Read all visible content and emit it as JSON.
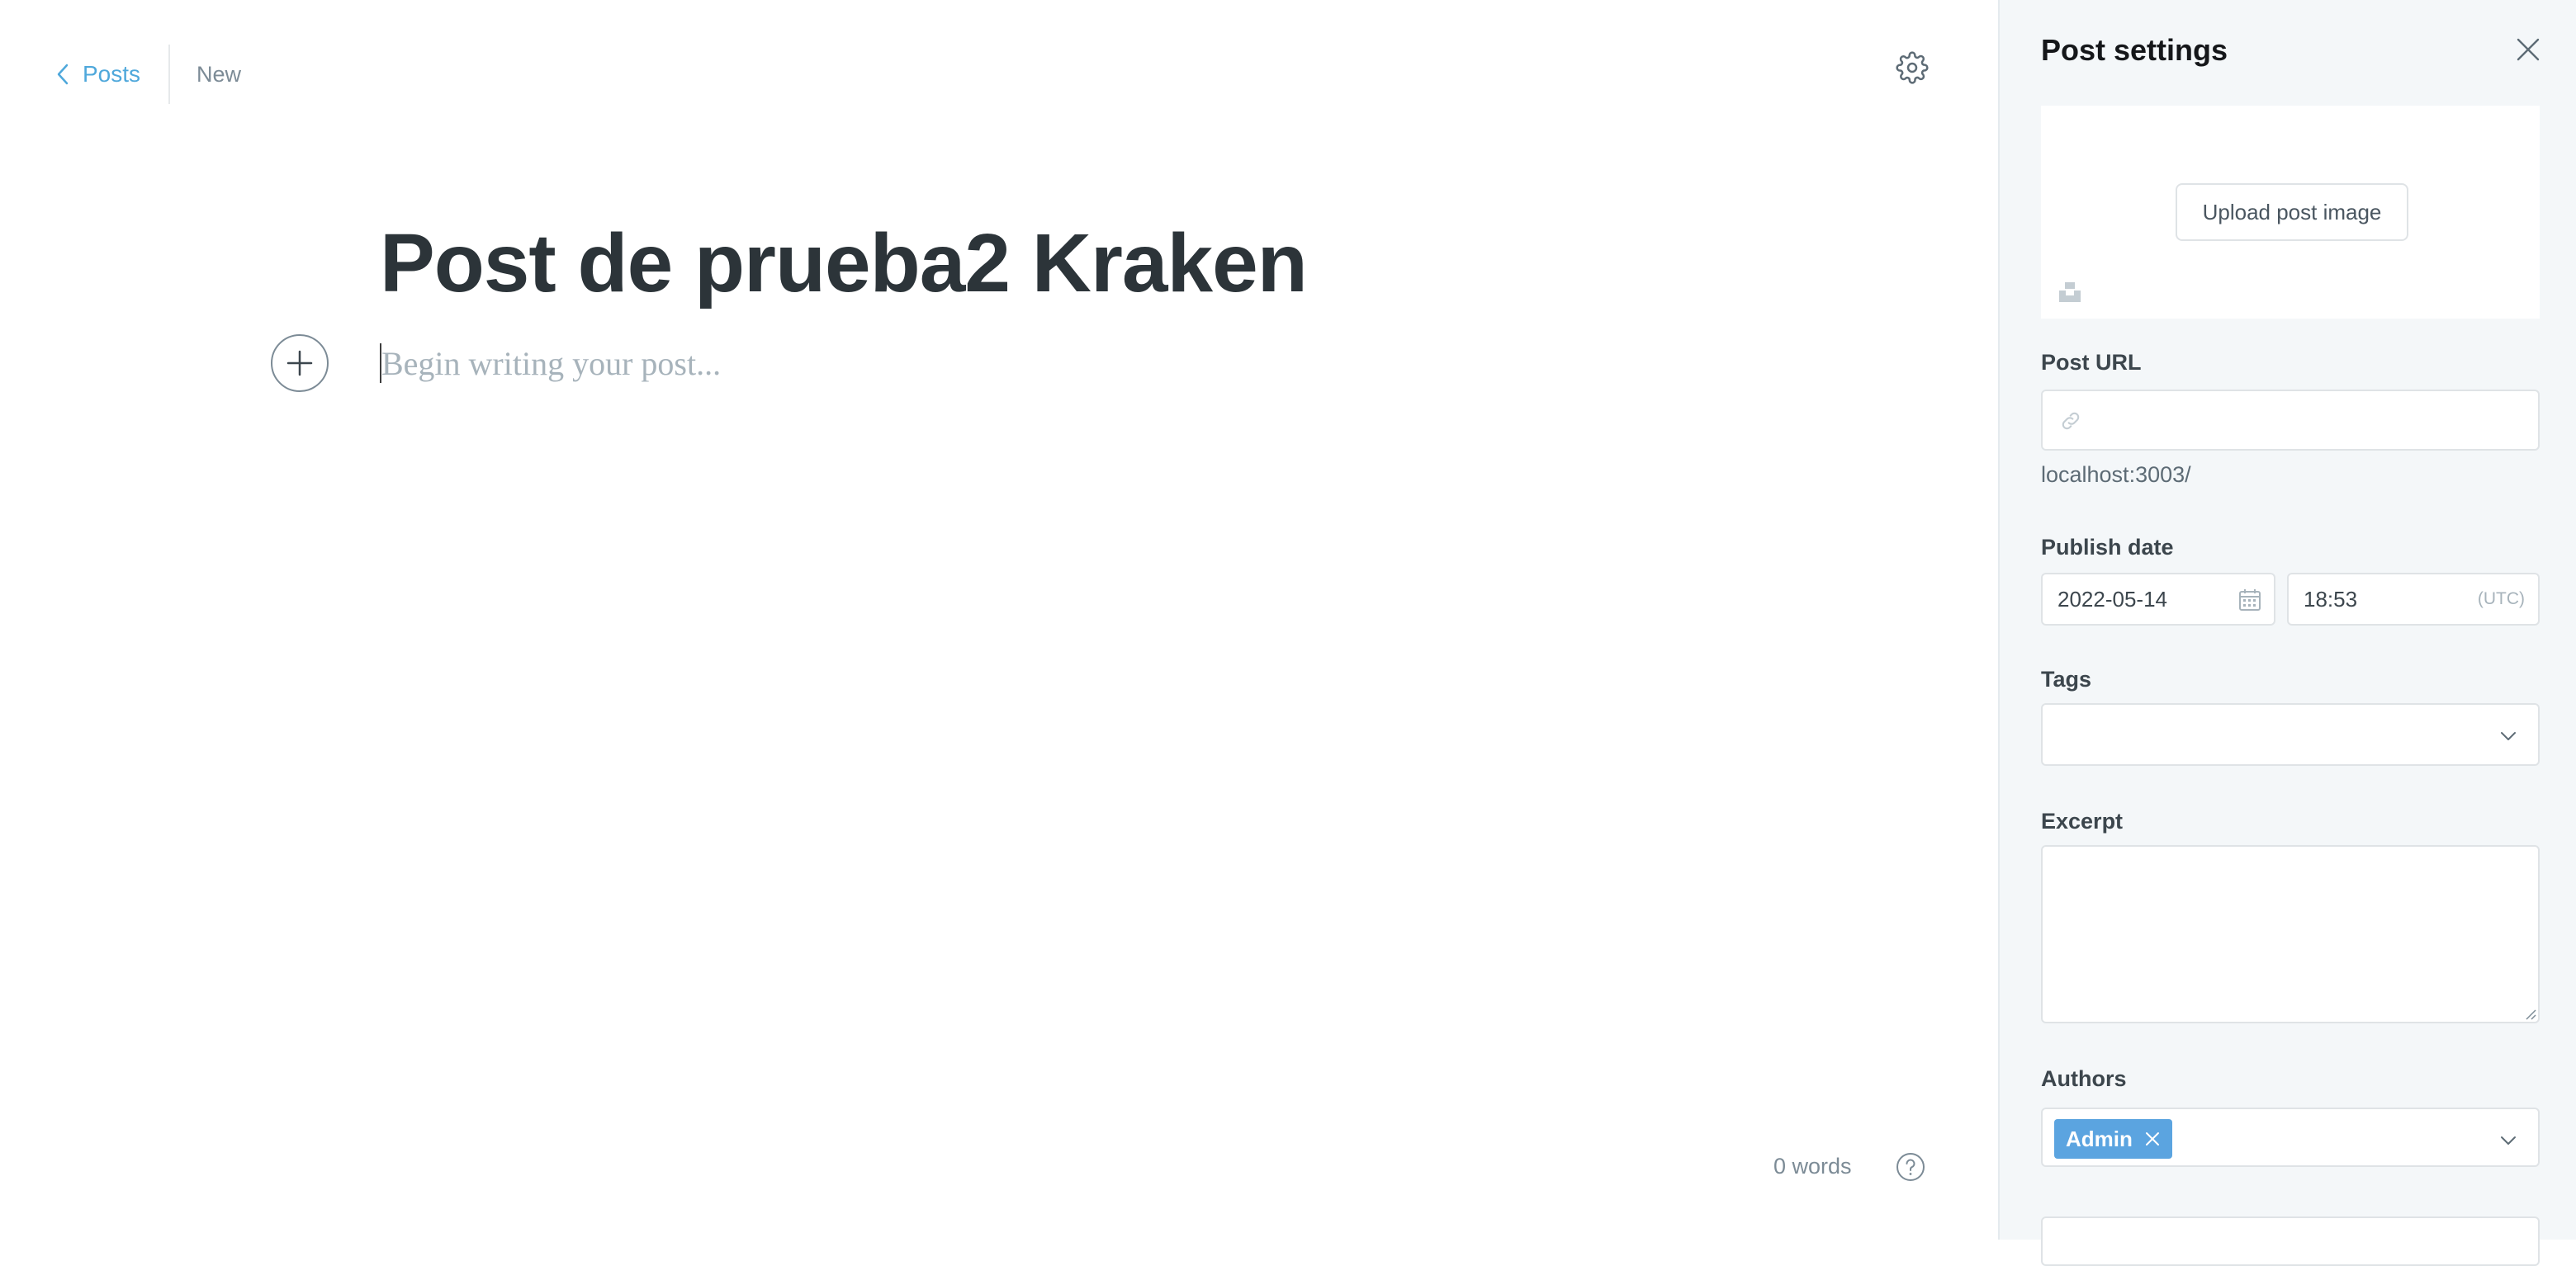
{
  "editor": {
    "back_label": "Posts",
    "status": "New",
    "title": "Post de prueba2 Kraken",
    "body_placeholder": "Begin writing your post...",
    "word_count": "0 words"
  },
  "settings": {
    "title": "Post settings",
    "upload_label": "Upload post image",
    "url_label": "Post URL",
    "url_value": "",
    "url_hint": "localhost:3003/",
    "publish_label": "Publish date",
    "date_value": "2022-05-14",
    "time_value": "18:53",
    "timezone": "(UTC)",
    "tags_label": "Tags",
    "excerpt_label": "Excerpt",
    "authors_label": "Authors",
    "authors": [
      "Admin"
    ]
  },
  "colors": {
    "accent": "#4fa8db",
    "token": "#5ba4e0",
    "panel_bg": "#f4f7f9",
    "title_text": "#2c3439"
  },
  "icons": [
    "chevron-left-icon",
    "gear-icon",
    "plus-icon",
    "help-icon",
    "close-icon",
    "unsplash-icon",
    "link-icon",
    "calendar-icon",
    "chevron-down-icon"
  ]
}
